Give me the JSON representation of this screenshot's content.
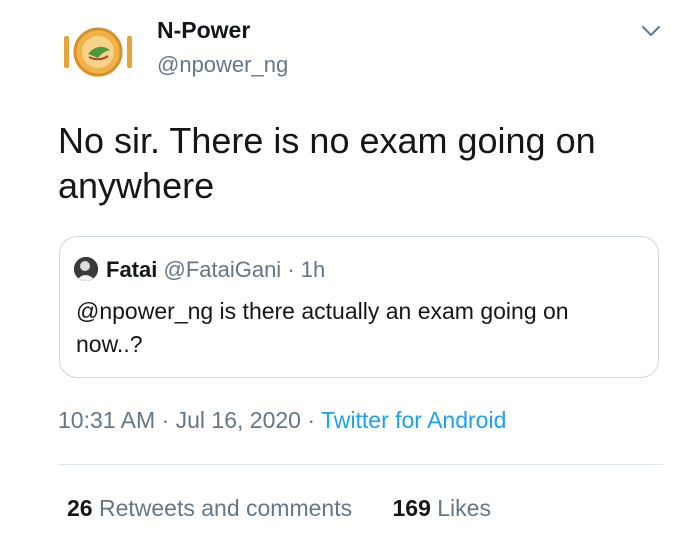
{
  "tweet": {
    "author": {
      "name": "N-Power",
      "handle": "@npower_ng"
    },
    "text": "No sir. There is no exam going on anywhere",
    "quoted": {
      "name": "Fatai",
      "handle": "@FataiGani",
      "separator": " · ",
      "time": "1h",
      "text": "@npower_ng is there actually an exam going on now..?"
    },
    "timestamp": {
      "time": "10:31 AM",
      "separator": " · ",
      "date": "Jul 16, 2020",
      "source": "Twitter for Android"
    },
    "stats": {
      "retweets_count": "26",
      "retweets_label": "Retweets and comments",
      "likes_count": "169",
      "likes_label": "Likes"
    }
  },
  "colors": {
    "text": "#14171a",
    "secondary": "#657786",
    "link": "#1da1f2",
    "border": "#ccd6dd",
    "logo_orange": "#e8a23c",
    "logo_green": "#4a9a3c"
  },
  "icons": {
    "caret": "chevron-down-icon",
    "author_logo": "npower-logo-icon"
  }
}
